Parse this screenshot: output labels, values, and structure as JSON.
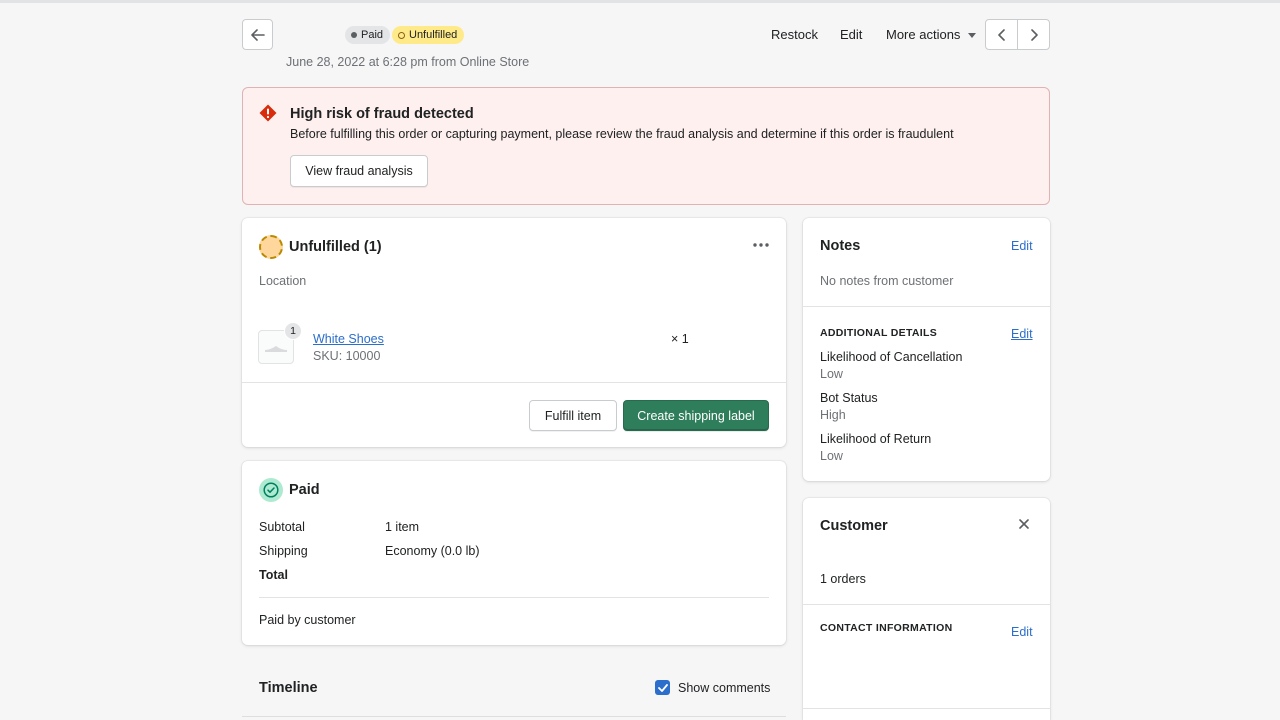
{
  "header": {
    "badges": {
      "paid": "Paid",
      "unfulfilled": "Unfulfilled"
    },
    "subtitle": "June 28, 2022 at 6:28 pm from Online Store",
    "actions": {
      "restock": "Restock",
      "edit": "Edit",
      "more": "More actions"
    }
  },
  "fraud_banner": {
    "title": "High risk of fraud detected",
    "message": "Before fulfilling this order or capturing payment, please review the fraud analysis and determine if this order is fraudulent",
    "button": "View fraud analysis"
  },
  "unfulfilled_card": {
    "title": "Unfulfilled (1)",
    "location_label": "Location",
    "item": {
      "name": "White Shoes",
      "sku": "SKU: 10000",
      "badge_qty": "1",
      "qty": "× 1"
    },
    "fulfill_button": "Fulfill item",
    "shipping_button": "Create shipping label"
  },
  "paid_card": {
    "title": "Paid",
    "rows": [
      {
        "label": "Subtotal",
        "value": "1 item"
      },
      {
        "label": "Shipping",
        "value": "Economy (0.0 lb)"
      },
      {
        "label": "Total",
        "value": ""
      }
    ],
    "paid_by": "Paid by customer"
  },
  "timeline": {
    "title": "Timeline",
    "show_comments": "Show comments",
    "show_comments_checked": true
  },
  "notes_card": {
    "title": "Notes",
    "edit": "Edit",
    "empty": "No notes from customer",
    "additional_title": "ADDITIONAL DETAILS",
    "additional_edit": "Edit",
    "details": [
      {
        "label": "Likelihood of Cancellation",
        "value": "Low"
      },
      {
        "label": "Bot Status",
        "value": "High"
      },
      {
        "label": "Likelihood of Return",
        "value": "Low"
      }
    ]
  },
  "customer_card": {
    "title": "Customer",
    "orders": "1 orders",
    "contact_title": "CONTACT INFORMATION",
    "contact_edit": "Edit"
  },
  "colors": {
    "primary": "#2e7d5b",
    "link": "#2c6ecb",
    "critical": "#d82c0d",
    "banner_bg": "#fdf0ef"
  },
  "icons": [
    "arrow-left-icon",
    "chevron-left-icon",
    "chevron-right-icon",
    "caret-down-icon",
    "alert-diamond-icon",
    "dots-horizontal-icon",
    "check-circle-icon",
    "close-icon",
    "checkmark-icon"
  ]
}
